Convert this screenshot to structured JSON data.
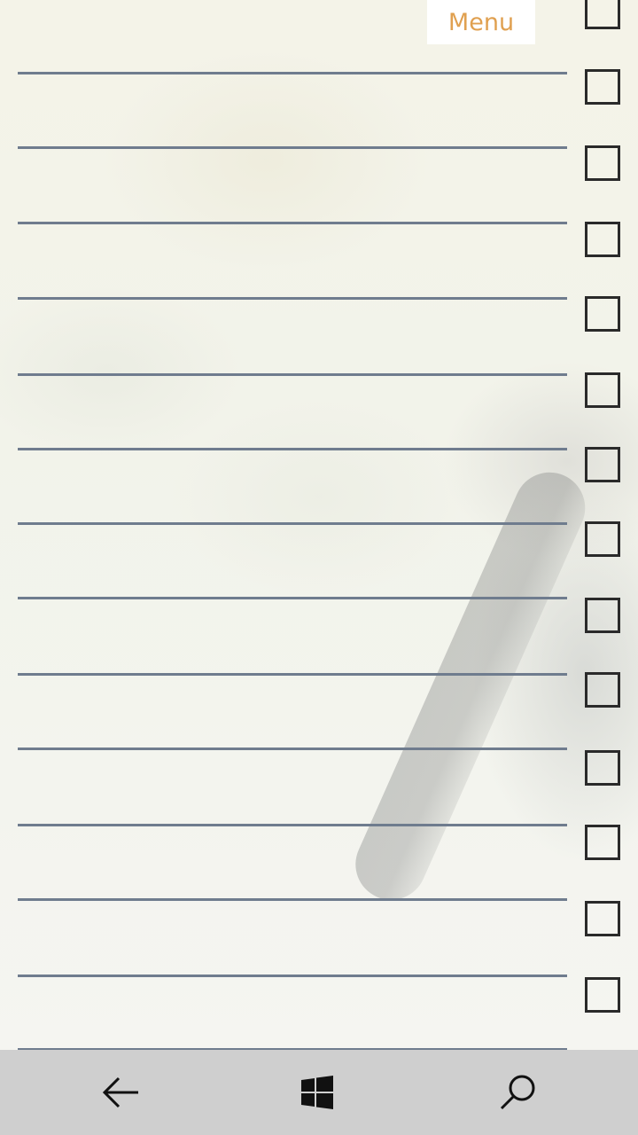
{
  "header": {
    "menu_label": "Menu"
  },
  "list": {
    "rows": 14,
    "checkboxes": [
      {
        "checked": false
      },
      {
        "checked": false
      },
      {
        "checked": false
      },
      {
        "checked": false
      },
      {
        "checked": false
      },
      {
        "checked": false
      },
      {
        "checked": false
      },
      {
        "checked": false
      },
      {
        "checked": false
      },
      {
        "checked": false
      },
      {
        "checked": false
      },
      {
        "checked": false
      },
      {
        "checked": false
      },
      {
        "checked": false
      }
    ]
  },
  "navbar": {
    "back_icon": "back-arrow-icon",
    "home_icon": "windows-logo-icon",
    "search_icon": "search-icon"
  },
  "colors": {
    "menu_text": "#e0a050",
    "rule_line": "#6f7c8e",
    "navbar_bg": "#cfcfcf"
  }
}
